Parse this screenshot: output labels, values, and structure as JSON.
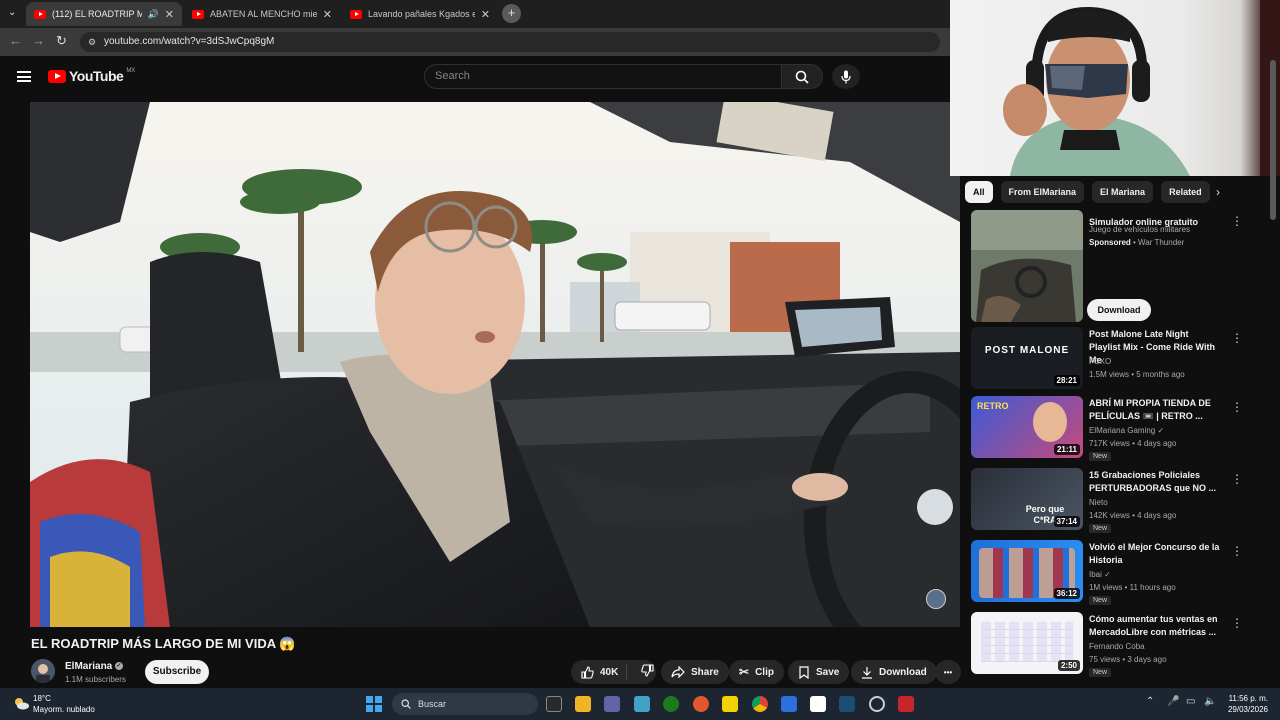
{
  "browser": {
    "tabs": [
      {
        "label": "(112) EL ROADTRIP MÁS LA",
        "active": true,
        "audio": true
      },
      {
        "label": "ABATEN AL MENCHO mientras",
        "active": false
      },
      {
        "label": "Lavando pañales Kgados en La",
        "active": false
      }
    ],
    "url": "youtube.com/watch?v=3dSJwCpq8gM"
  },
  "youtube": {
    "logo": "YouTube",
    "country": "MX",
    "search_placeholder": "Search"
  },
  "video": {
    "title": "EL ROADTRIP MÁS LARGO DE MI VIDA 😱",
    "channel": "ElMariana",
    "subscribers": "1.1M subscribers",
    "subscribe_label": "Subscribe",
    "likes": "40K",
    "share_label": "Share",
    "clip_label": "Clip",
    "save_label": "Save",
    "download_label": "Download",
    "more_label": "•••"
  },
  "chips": [
    "All",
    "From ElMariana",
    "El Mariana",
    "Related"
  ],
  "recommendations": [
    {
      "title": "Simulador online gratuito",
      "sub": "Juego de vehículos militares",
      "sponsored": "Sponsored",
      "sponsor": " • War Thunder",
      "button": "Download"
    },
    {
      "title": "Post Malone Late Night Playlist Mix - Come Ride With Me",
      "channel": "FCXO",
      "meta": "1.5M views • 5 months ago",
      "duration": "28:21",
      "thumb_text": "POST MALONE"
    },
    {
      "title": "ABRÍ MI PROPIA TIENDA DE PELÍCULAS 📼 | RETRO ...",
      "channel": "ElMariana Gaming",
      "meta": "717K views • 4 days ago",
      "duration": "21:11",
      "badge": "New",
      "thumb_text": "RETRO"
    },
    {
      "title": "15 Grabaciones Policiales PERTURBADORAS que NO ...",
      "channel": "Nieto",
      "meta": "142K views • 4 days ago",
      "duration": "37:14",
      "badge": "New",
      "thumb_text": "Pero que C*RA"
    },
    {
      "title": "Volvió el Mejor Concurso de la Historia",
      "channel": "Ibai",
      "meta": "1M views • 11 hours ago",
      "duration": "36:12",
      "badge": "New"
    },
    {
      "title": "Cómo aumentar tus ventas en MercadoLibre con métricas ...",
      "channel": "Fernando Coba",
      "meta": "75 views • 3 days ago",
      "duration": "2:50",
      "badge": "New"
    }
  ],
  "taskbar": {
    "temp": "18°C",
    "weather": "Mayorm. nublado",
    "search": "Buscar",
    "time": "11:56 p. m.",
    "date": "29/03/2026"
  }
}
